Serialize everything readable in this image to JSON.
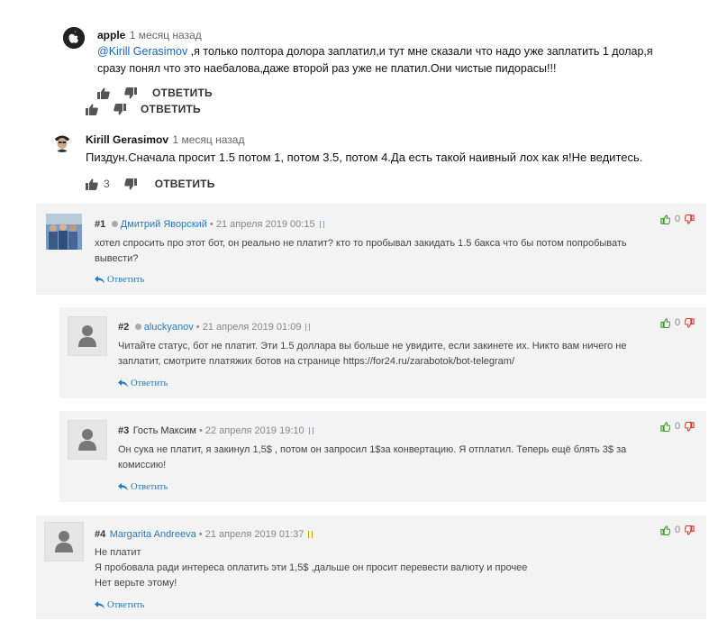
{
  "yt": {
    "comment1": {
      "author": "apple",
      "time": "1 месяц назад",
      "mention": "@Kirill Gerasimov",
      "text_line1": " ,я только полтора долора заплатил,и тут мне сказали что надо уже заплатить 1 долар,я",
      "text_line2": "сразу понял что это наебалова,даже второй раз уже не платил.Они чистые пидорасы!!!",
      "reply_label": "ОТВЕТИТЬ"
    },
    "outer_reply_label": "ОТВЕТИТЬ",
    "comment2": {
      "author": "Kirill Gerasimov",
      "time": "1 месяц назад",
      "text": "Пиздун.Сначала просит 1.5 потом 1, потом 3.5, потом 4.Да есть такой наивный лох как я!Не ведитесь.",
      "likes": "3",
      "reply_label": "ОТВЕТИТЬ"
    }
  },
  "forum": {
    "reply_label": "Ответить",
    "comments": [
      {
        "num": "#1",
        "author": "Дмитрий Яворский",
        "date": " • 21 апреля 2019 00:15",
        "line1": "хотел спросить про этот бот, он реально не платит? кто то пробывал закидать 1.5 бакса что бы потом попробывать",
        "line2": "вывести?",
        "line3": "",
        "votes": "0"
      },
      {
        "num": "#2",
        "author": "aluckyanov",
        "date": " • 21 апреля 2019 01:09",
        "line1": "Читайте статус, бот не платит. Эти 1.5 доллара вы больше не увидите, если закинете их. Никто вам ничего не",
        "line2": "заплатит, смотрите платяжих ботов на странице https://for24.ru/zarabotok/bot-telegram/",
        "line3": "",
        "votes": "0"
      },
      {
        "num": "#3",
        "author": "Гость Максим",
        "date": " • 22 апреля 2019 19:10",
        "line1": "Он сука не платит, я закинул 1,5$ , потом он запросил 1$за конвертацию. Я отплатил. Теперь ещё блять 3$ за",
        "line2": "комиссию!",
        "line3": "",
        "votes": "0"
      },
      {
        "num": "#4",
        "author": "Margarita Andreeva",
        "date": " • 21 апреля 2019 01:37",
        "line1": "Не платит",
        "line2": "Я пробовала ради интереса оплатить эти 1,5$ ,дальше он просит перевести валюту и прочее",
        "line3": "Нет верьте этому!",
        "votes": "0"
      }
    ]
  },
  "icons": {
    "like": "thumbs-up-icon",
    "dislike": "thumbs-down-icon",
    "reply": "reply-arrow-icon",
    "upvote": "upvote-thumb-icon",
    "downvote": "downvote-thumb-icon",
    "flag": "report-flag-icon"
  },
  "colors": {
    "link": "#2a7ab9",
    "upvote": "#3a9a2a",
    "downvote": "#d33a2c",
    "card_bg": "#f3f3f3"
  }
}
